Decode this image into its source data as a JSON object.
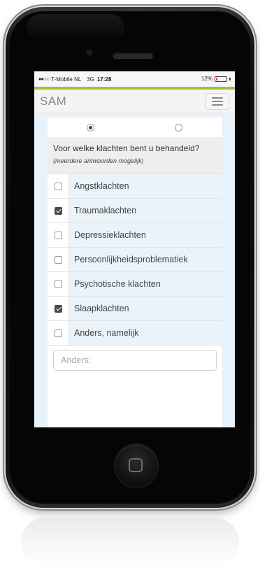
{
  "status_bar": {
    "signal": "●●○○○",
    "carrier": "T-Mobile NL",
    "network": "3G",
    "time": "17:28",
    "battery_percent": "12%",
    "battery_level": 0.12
  },
  "accent_color": "#9bc33b",
  "navbar": {
    "brand": "SAM",
    "menu_icon": "hamburger-icon"
  },
  "radio_options": [
    {
      "selected": true
    },
    {
      "selected": false
    }
  ],
  "question": {
    "text": "Voor welke klachten bent u behandeld?",
    "hint": "(meerdere antwoorden mogelijk)"
  },
  "options": [
    {
      "label": "Angstklachten",
      "checked": false
    },
    {
      "label": "Traumaklachten",
      "checked": true
    },
    {
      "label": "Depressieklachten",
      "checked": false
    },
    {
      "label": "Persoonlijkheidsproblematiek",
      "checked": false
    },
    {
      "label": "Psychotische klachten",
      "checked": false
    },
    {
      "label": "Slaapklachten",
      "checked": true
    },
    {
      "label": "Anders, namelijk",
      "checked": false
    }
  ],
  "other_input": {
    "placeholder": "Anders:",
    "value": ""
  }
}
